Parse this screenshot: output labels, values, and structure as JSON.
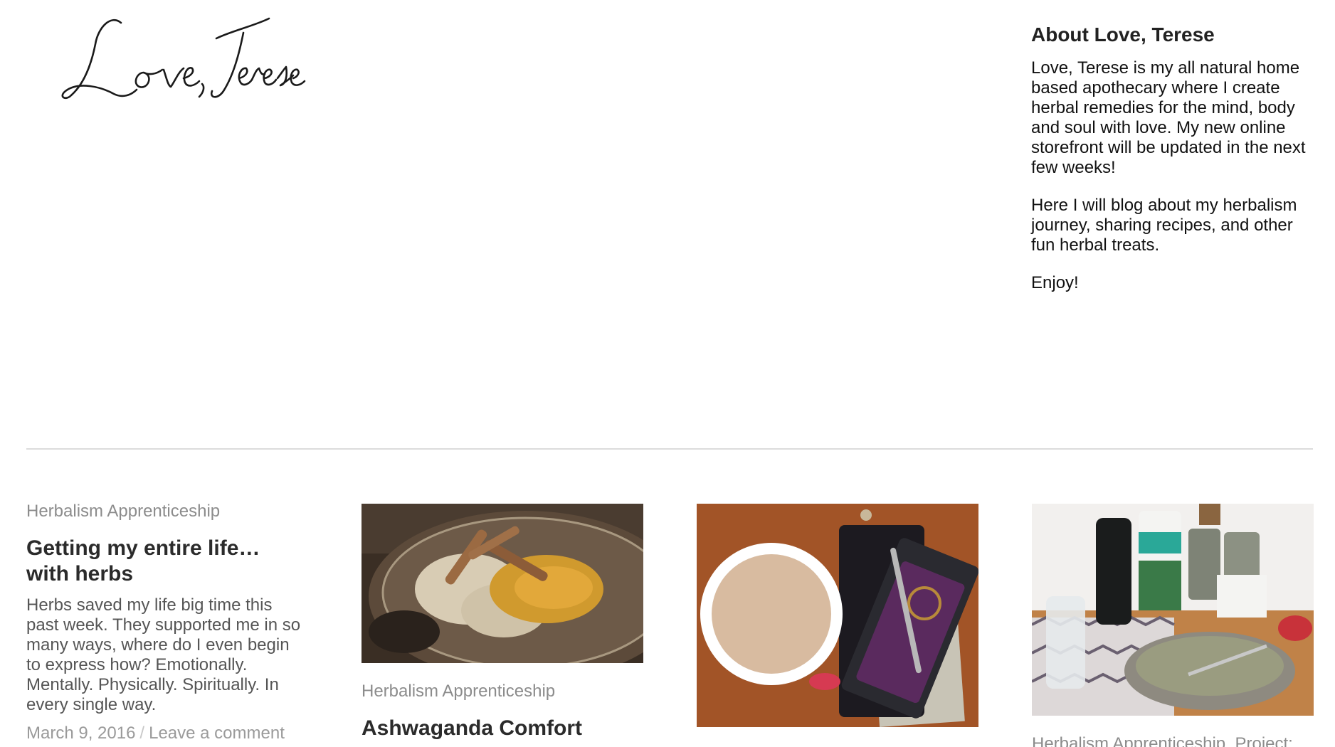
{
  "site": {
    "logo_text": "Love, Terese"
  },
  "about": {
    "heading": "About Love, Terese",
    "paragraphs": [
      "Love, Terese is my all natural home based apothecary where I create herbal remedies for the mind, body and soul with love. My new online storefront will be updated in the next few weeks!",
      "Here I will blog about my herbalism journey, sharing recipes, and other fun herbal treats.",
      "Enjoy!"
    ]
  },
  "posts": [
    {
      "category": "Herbalism Apprenticeship",
      "title": "Getting my entire life… with herbs",
      "excerpt": "Herbs saved my life big time this past week. They supported me in so many ways, where do I even begin to express how? Emotionally. Mentally. Physically. Spiritually. In every single way.",
      "date": "March 9, 2016",
      "comment_link": "Leave a comment"
    },
    {
      "category": "Herbalism Apprenticeship",
      "title": "Ashwaganda Comfort",
      "image_desc": "glass bowl with cinnamon sticks, shredded root and turmeric"
    },
    {
      "image_desc": "mug of herbal latte beside notebook and pen"
    },
    {
      "category": "Herbalism Apprenticeship, Project:",
      "image_desc": "coconut oil, herb jars and mixing bowl on table"
    }
  ],
  "colors": {
    "text": "#111111",
    "category": "#8c8c8c",
    "divider": "#dcdcdc"
  }
}
